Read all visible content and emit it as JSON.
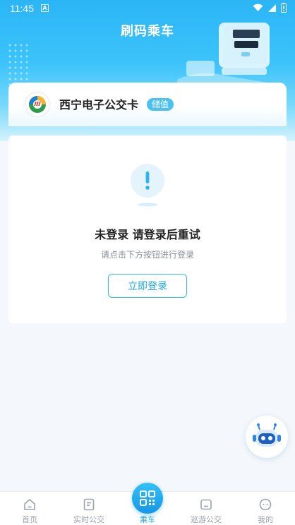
{
  "status_bar": {
    "time": "11:45",
    "notification_letter": "A",
    "icons": [
      "wifi-icon",
      "signal-icon",
      "battery-icon"
    ]
  },
  "header": {
    "title": "刷码乘车"
  },
  "card": {
    "name": "西宁电子公交卡",
    "badge": "储值"
  },
  "empty_state": {
    "icon": "exclamation-icon",
    "title": "未登录 请登录后重试",
    "subtitle": "请点击下方按钮进行登录",
    "button_label": "立即登录"
  },
  "tabs": [
    {
      "label": "首页",
      "icon": "home-icon"
    },
    {
      "label": "实时公交",
      "icon": "realtime-bus-icon"
    },
    {
      "label": "乘车",
      "icon": "qr-code-icon"
    },
    {
      "label": "巡游公交",
      "icon": "tour-bus-icon"
    },
    {
      "label": "我的",
      "icon": "profile-icon"
    }
  ],
  "colors": {
    "accent": "#1ea9e6",
    "header_gradient_top": "#2bb5f6",
    "badge": "#4cc1ef",
    "tab_inactive": "#9aa2ad"
  }
}
